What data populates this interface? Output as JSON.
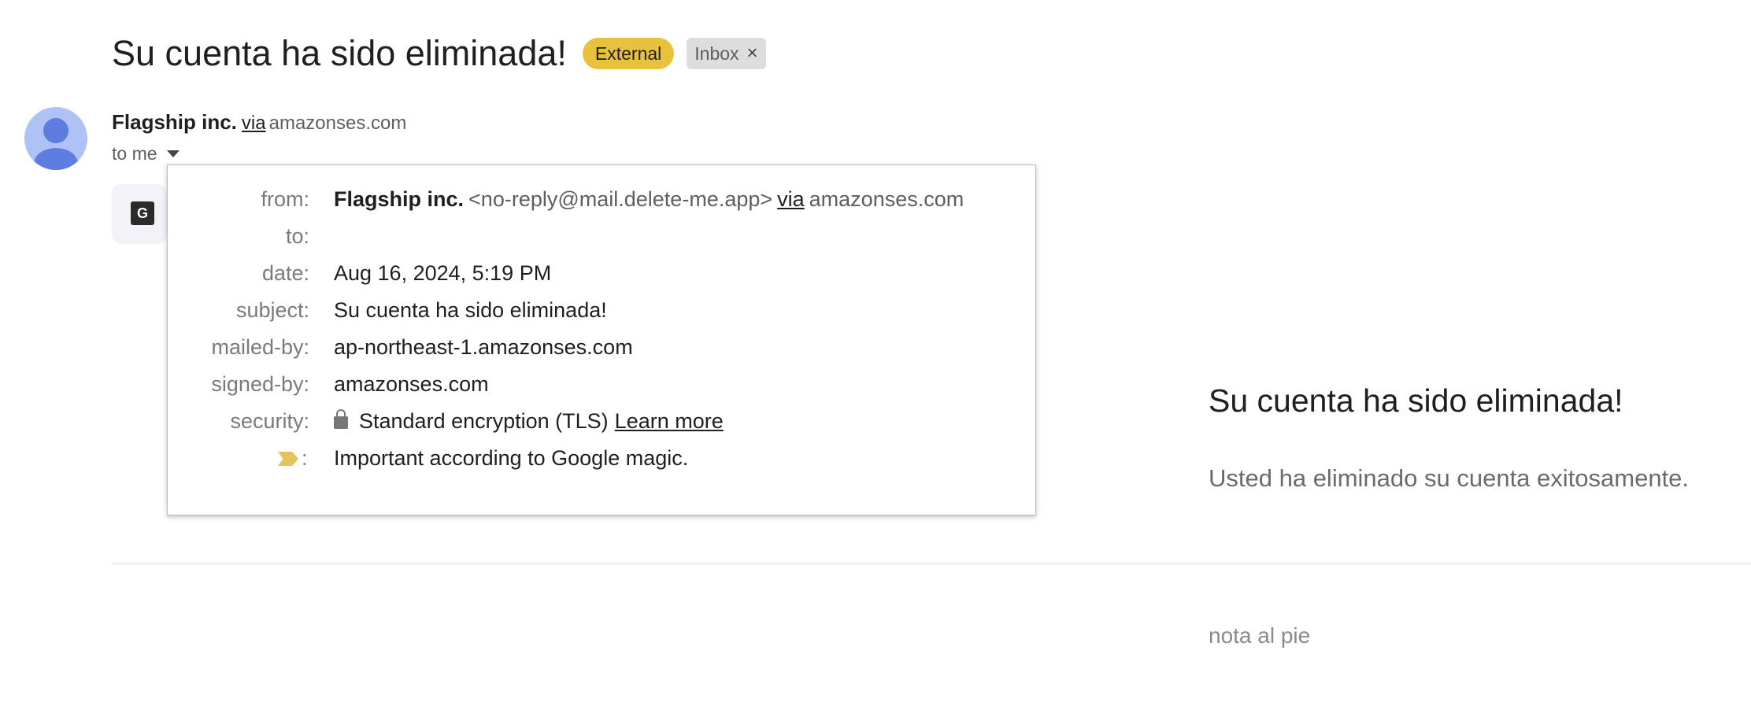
{
  "subject": {
    "title": "Su cuenta ha sido eliminada!",
    "labels": {
      "external": "External",
      "inbox": "Inbox",
      "close": "×"
    }
  },
  "sender": {
    "name": "Flagship inc.",
    "via": "via",
    "domain": "amazonses.com"
  },
  "recipient": {
    "to_me": "to me"
  },
  "details": {
    "from_label": "from:",
    "from_name": "Flagship inc.",
    "from_email": "<no-reply@mail.delete-me.app>",
    "from_via": "via",
    "from_domain": "amazonses.com",
    "to_label": "to:",
    "date_label": "date:",
    "date_value": "Aug 16, 2024, 5:19 PM",
    "subject_label": "subject:",
    "subject_value": "Su cuenta ha sido eliminada!",
    "mailed_by_label": "mailed-by:",
    "mailed_by_value": "ap-northeast-1.amazonses.com",
    "signed_by_label": "signed-by:",
    "signed_by_value": "amazonses.com",
    "security_label": "security:",
    "security_value": "Standard encryption (TLS)",
    "learn_more": "Learn more",
    "importance_colon": ":",
    "importance_value": "Important according to Google magic."
  },
  "body": {
    "title": "Su cuenta ha sido eliminada!",
    "text": "Usted ha eliminado su cuenta exitosamente.",
    "footnote": "nota al pie"
  },
  "icons": {
    "avatar": "person-avatar-icon",
    "caret": "caret-down-icon",
    "translate": "translate-icon",
    "lock": "lock-icon",
    "importance": "importance-marker-icon",
    "close": "close-icon"
  },
  "colors": {
    "external_chip": "#e8c23c",
    "avatar_bg": "#aec2f6",
    "avatar_fg": "#5d7de0",
    "importance": "#e2c45c"
  }
}
